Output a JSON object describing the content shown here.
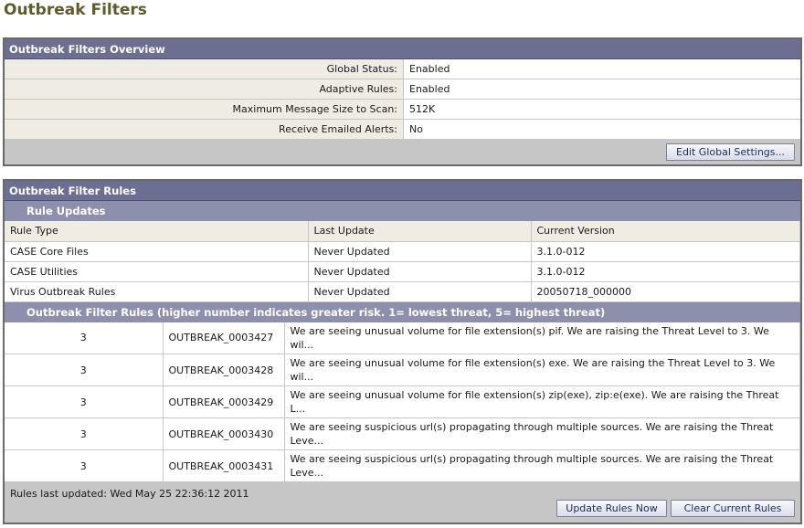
{
  "page": {
    "title": "Outbreak Filters"
  },
  "overview": {
    "header": "Outbreak Filters Overview",
    "rows": [
      {
        "label": "Global Status:",
        "value": "Enabled"
      },
      {
        "label": "Adaptive Rules:",
        "value": "Enabled"
      },
      {
        "label": "Maximum Message Size to Scan:",
        "value": "512K"
      },
      {
        "label": "Receive Emailed Alerts:",
        "value": "No"
      }
    ],
    "edit_button": "Edit Global Settings..."
  },
  "rules": {
    "header": "Outbreak Filter Rules",
    "updates": {
      "subheader": "Rule Updates",
      "columns": [
        "Rule Type",
        "Last Update",
        "Current Version"
      ],
      "rows": [
        [
          "CASE Core Files",
          "Never Updated",
          "3.1.0-012"
        ],
        [
          "CASE Utilities",
          "Never Updated",
          "3.1.0-012"
        ],
        [
          "Virus Outbreak Rules",
          "Never Updated",
          "20050718_000000"
        ]
      ]
    },
    "filters": {
      "subheader": "Outbreak Filter Rules (higher number indicates greater risk. 1= lowest threat, 5= highest threat)",
      "rows": [
        {
          "level": "3",
          "id": "OUTBREAK_0003427",
          "desc": "We are seeing unusual volume for file extension(s) pif. We are raising the Threat Level to 3. We wil..."
        },
        {
          "level": "3",
          "id": "OUTBREAK_0003428",
          "desc": "We are seeing unusual volume for file extension(s) exe. We are raising the Threat Level to 3. We wil..."
        },
        {
          "level": "3",
          "id": "OUTBREAK_0003429",
          "desc": "We are seeing unusual volume for file extension(s) zip(exe), zip:e(exe). We are raising the Threat L..."
        },
        {
          "level": "3",
          "id": "OUTBREAK_0003430",
          "desc": "We are seeing suspicious url(s) propagating through multiple sources. We are raising the Threat Leve..."
        },
        {
          "level": "3",
          "id": "OUTBREAK_0003431",
          "desc": "We are seeing suspicious url(s) propagating through multiple sources. We are raising the Threat Leve..."
        }
      ]
    },
    "last_updated": "Rules last updated: Wed May 25 22:36:12 2011",
    "update_button": "Update Rules Now",
    "clear_button": "Clear Current Rules"
  }
}
